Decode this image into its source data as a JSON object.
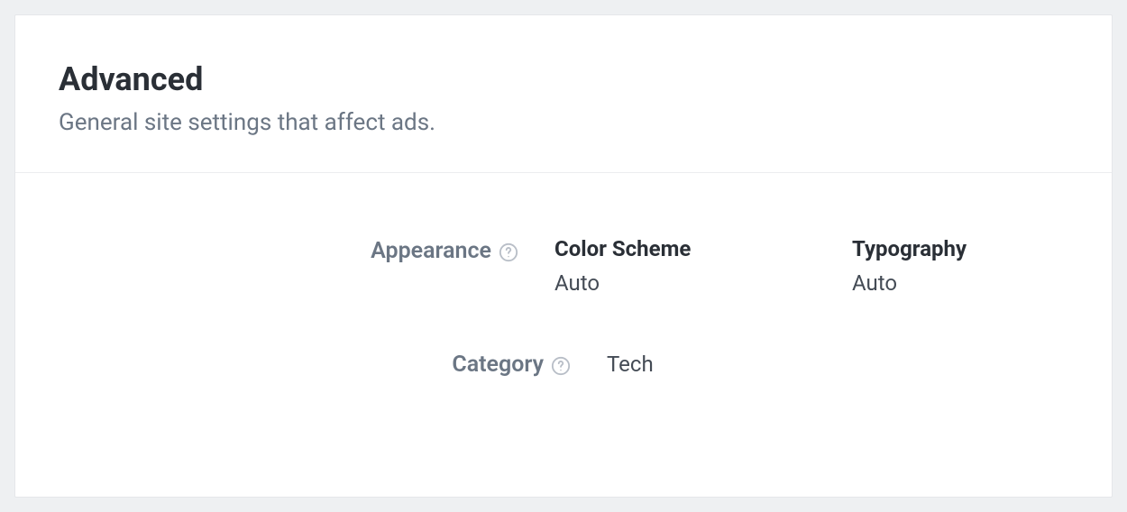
{
  "header": {
    "title": "Advanced",
    "subtitle": "General site settings that affect ads."
  },
  "rows": {
    "appearance": {
      "label": "Appearance",
      "colorScheme": {
        "label": "Color Scheme",
        "value": "Auto"
      },
      "typography": {
        "label": "Typography",
        "value": "Auto"
      }
    },
    "category": {
      "label": "Category",
      "value": "Tech"
    }
  }
}
